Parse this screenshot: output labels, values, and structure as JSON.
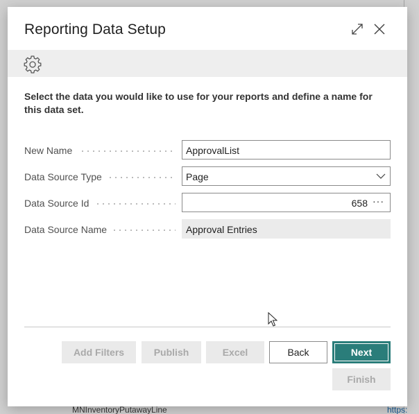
{
  "dialog": {
    "title": "Reporting Data Setup",
    "expand_icon": "expand-icon",
    "close_icon": "close-icon"
  },
  "actionbar": {
    "settings_icon": "gear-icon"
  },
  "instructions": "Select the data you would like to use for your reports and define a name for this data set.",
  "fields": {
    "new_name": {
      "label": "New Name",
      "value": "ApprovalList"
    },
    "data_source_type": {
      "label": "Data Source Type",
      "value": "Page"
    },
    "data_source_id": {
      "label": "Data Source Id",
      "value": "658",
      "lookup": "···"
    },
    "data_source_name": {
      "label": "Data Source Name",
      "value": "Approval Entries"
    }
  },
  "buttons": {
    "add_filters": "Add Filters",
    "publish": "Publish",
    "excel": "Excel",
    "back": "Back",
    "next": "Next",
    "finish": "Finish"
  },
  "background": {
    "bottom_text": "MNInventoryPutawayLine",
    "bottom_link": "https:"
  },
  "colors": {
    "primary": "#2a7d7a",
    "actionbar": "#eeeeee",
    "disabled": "#eaeaea"
  }
}
